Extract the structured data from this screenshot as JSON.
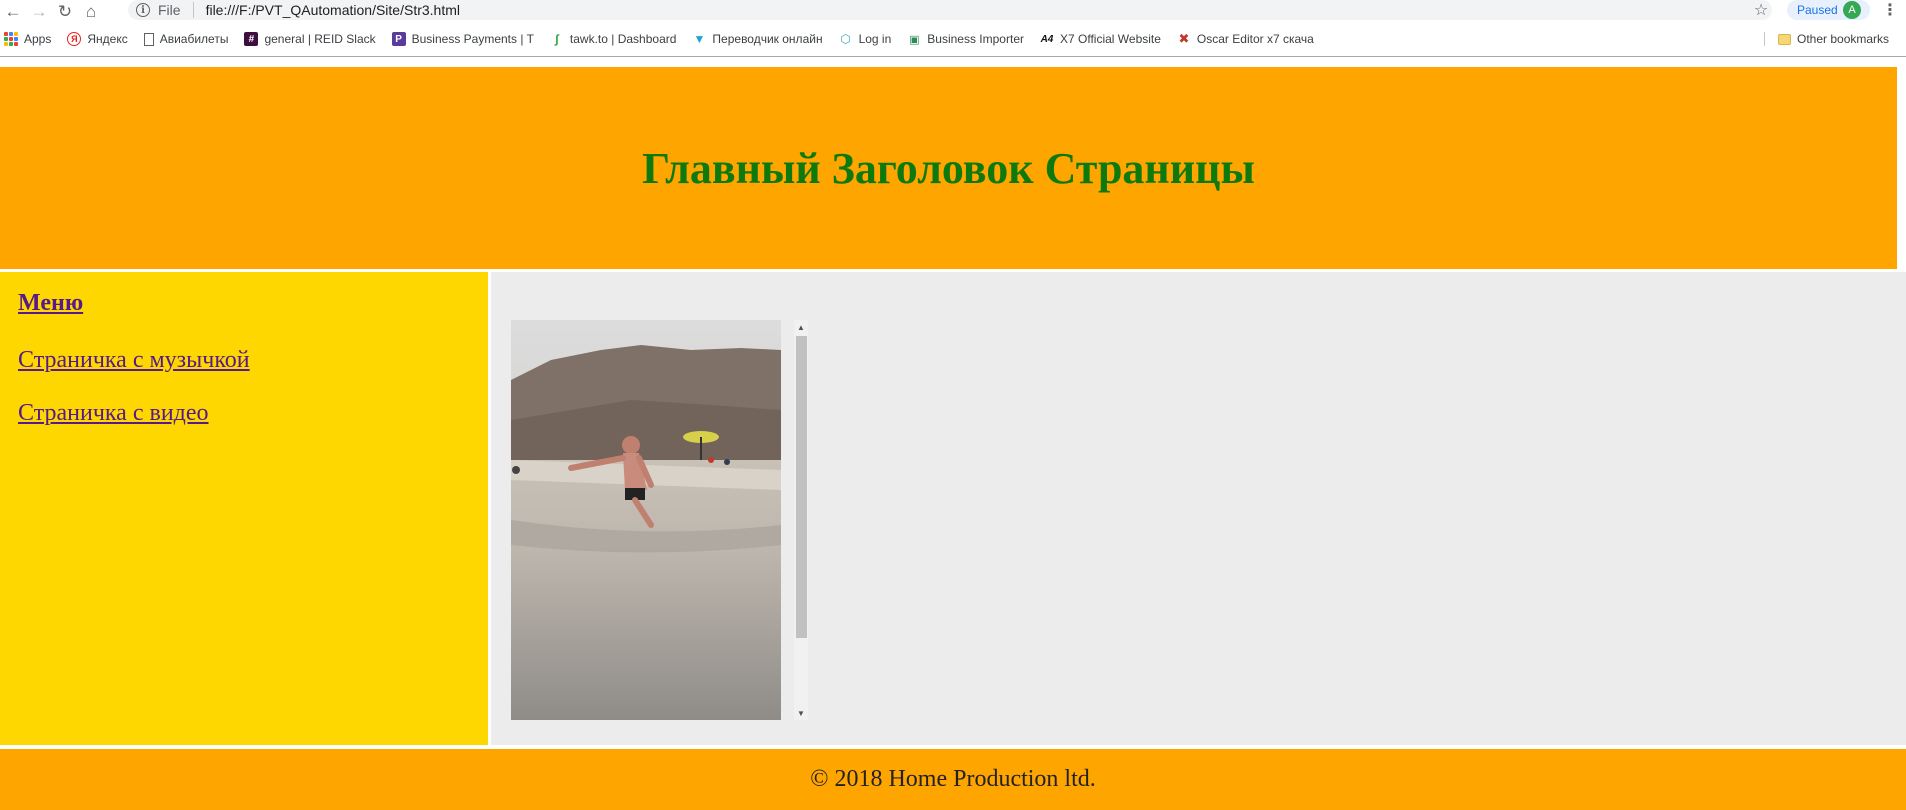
{
  "browser": {
    "url_scheme": "File",
    "url": "file:///F:/PVT_QAutomation/Site/Str3.html",
    "profile_status": "Paused",
    "profile_initial": "A"
  },
  "bookmarks": [
    {
      "label": "Apps",
      "icon": "apps-grid-icon"
    },
    {
      "label": "Яндекс",
      "icon": "yandex-icon"
    },
    {
      "label": "Авиабилеты",
      "icon": "page-icon"
    },
    {
      "label": "general | REID Slack",
      "icon": "slack-icon"
    },
    {
      "label": "Business Payments | T",
      "icon": "payments-icon"
    },
    {
      "label": "tawk.to | Dashboard",
      "icon": "tawk-icon"
    },
    {
      "label": "Переводчик онлайн",
      "icon": "translator-icon"
    },
    {
      "label": "Log in",
      "icon": "login-icon"
    },
    {
      "label": "Business Importer",
      "icon": "importer-icon"
    },
    {
      "label": "X7 Official Website",
      "icon": "x7-icon"
    },
    {
      "label": "Oscar Editor x7 скача",
      "icon": "oscar-icon"
    }
  ],
  "other_bookmarks": "Other bookmarks",
  "page": {
    "title": "Главный Заголовок Страницы",
    "menu": {
      "title": "Меню",
      "items": [
        "Страничка с музычкой",
        "Страничка с видео"
      ]
    },
    "footer": "© 2018 Home Production ltd."
  },
  "colors": {
    "header_bg": "#ffa500",
    "title": "#0e7a0e",
    "sidebar_bg": "#ffd700",
    "content_bg": "#ececec",
    "link": "#551a8b"
  }
}
